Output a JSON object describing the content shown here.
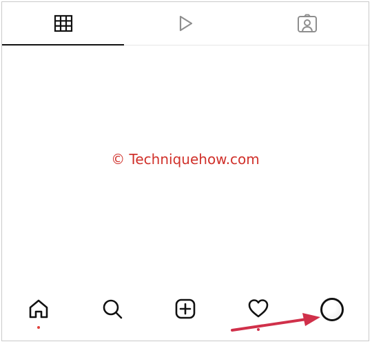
{
  "tabs": [
    {
      "icon": "grid-icon",
      "active": true
    },
    {
      "icon": "reels-play-icon",
      "active": false
    },
    {
      "icon": "tagged-person-icon",
      "active": false
    }
  ],
  "watermark": "© Techniquehow.com",
  "bottom_nav": [
    {
      "icon": "home-icon"
    },
    {
      "icon": "search-icon"
    },
    {
      "icon": "new-post-icon"
    },
    {
      "icon": "heart-icon"
    },
    {
      "icon": "profile-avatar"
    }
  ],
  "colors": {
    "icon": "#111111",
    "inactive_icon": "#8e8e8e",
    "watermark": "#d0302a",
    "arrow": "#d0304a"
  }
}
